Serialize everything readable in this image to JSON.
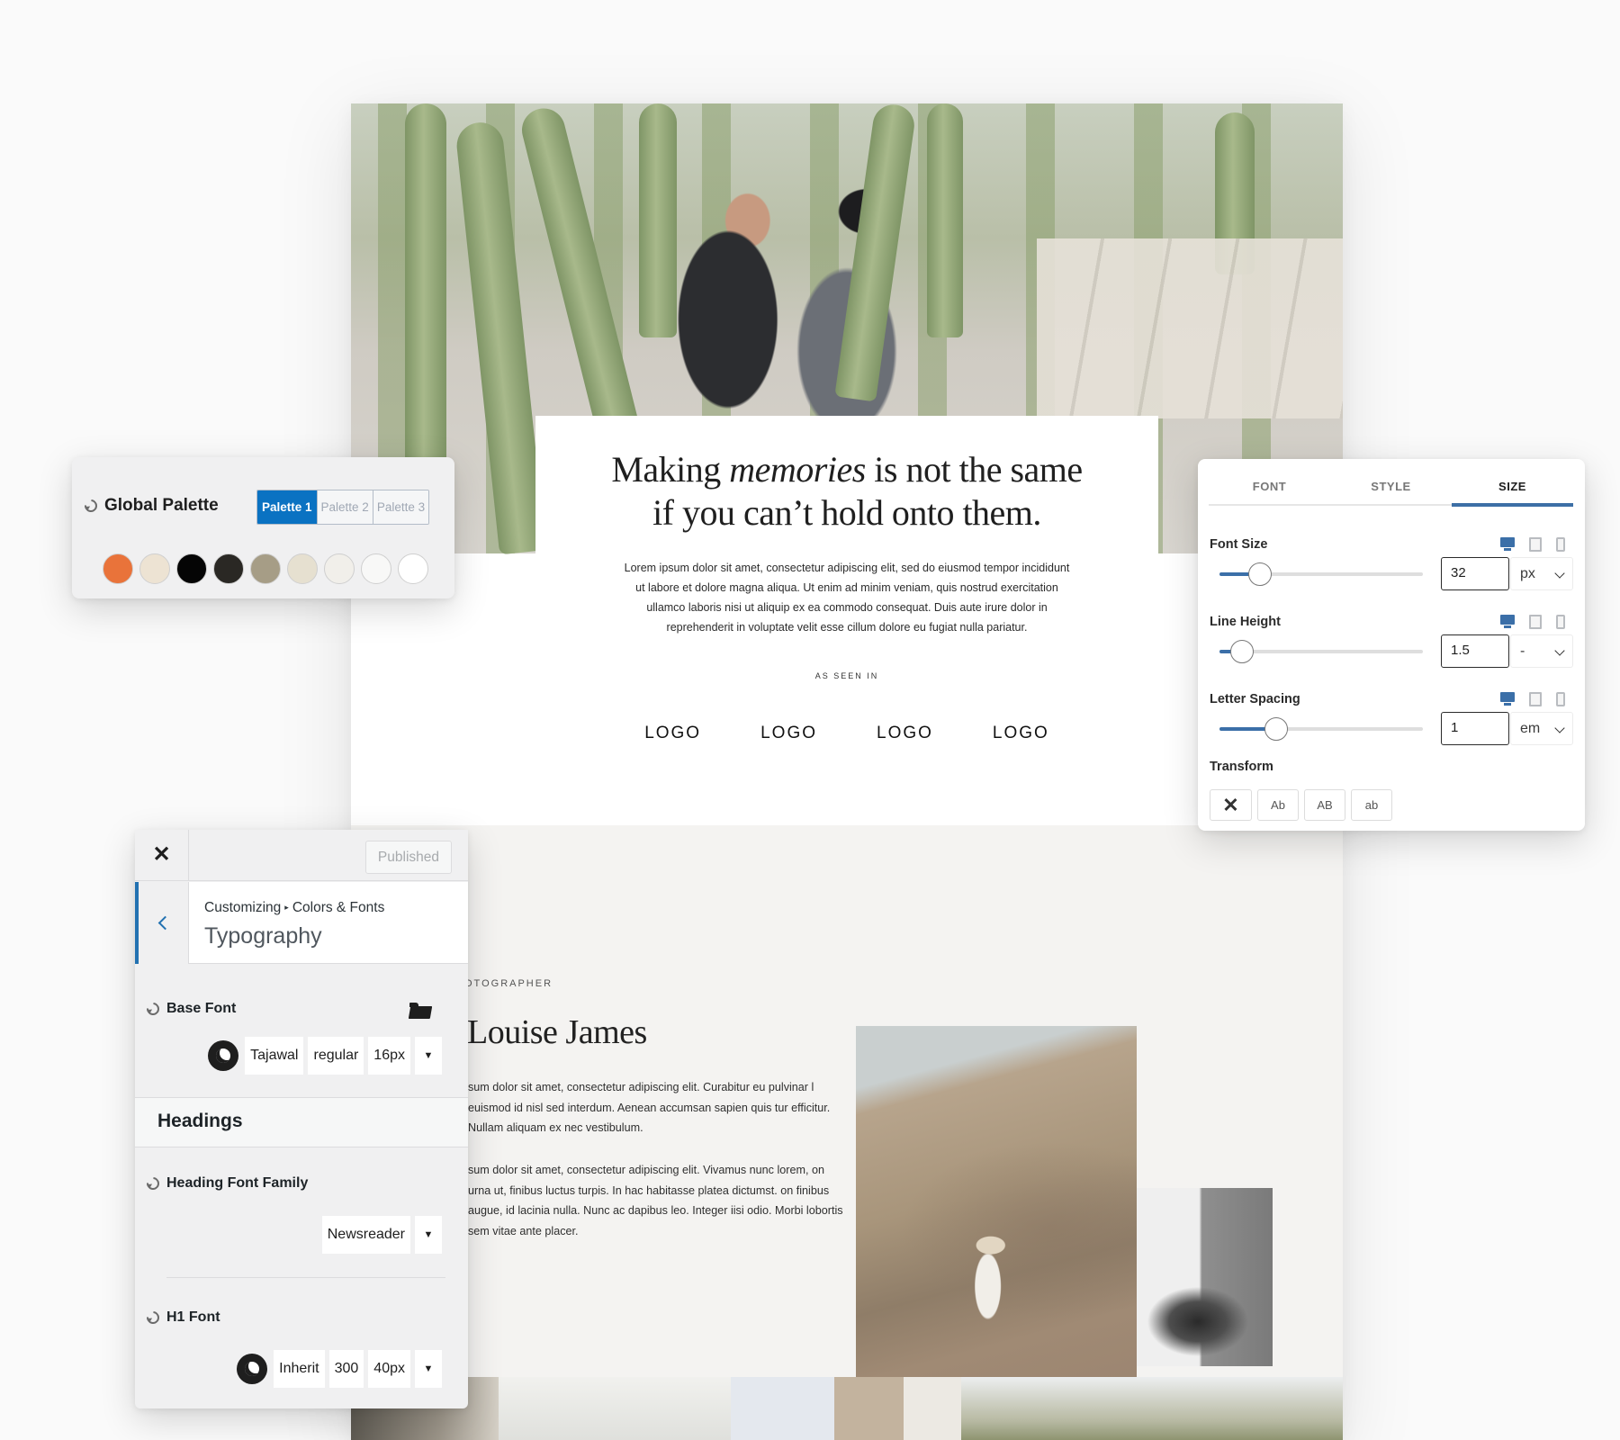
{
  "site": {
    "hero": {
      "title_before": "Making ",
      "title_italic": "memories",
      "title_after": " is not the same",
      "title_line2": "if you can’t hold onto them.",
      "body": "Lorem ipsum dolor sit amet, consectetur adipiscing elit, sed do eiusmod tempor incididunt ut labore et dolore magna aliqua. Ut enim ad minim veniam, quis nostrud exercitation ullamco laboris nisi ut aliquip ex ea commodo consequat. Duis aute irure dolor in reprehenderit in voluptate velit esse cillum dolore eu fugiat nulla pariatur.",
      "as_seen_in": "AS SEEN IN",
      "logos": [
        "LOGO",
        "LOGO",
        "LOGO",
        "LOGO"
      ]
    },
    "about": {
      "eyebrow": "OTOGRAPHER",
      "name": "Louise James",
      "paragraph1": "sum dolor sit amet, consectetur adipiscing elit. Curabitur eu pulvinar l euismod id nisl sed interdum. Aenean accumsan sapien quis tur efficitur. Nullam aliquam ex nec vestibulum.",
      "paragraph2": "sum dolor sit amet, consectetur adipiscing elit. Vivamus nunc lorem, on urna ut, finibus luctus turpis. In hac habitasse platea dictumst. on finibus augue, id lacinia nulla. Nunc ac dapibus leo. Integer iisi odio. Morbi lobortis sem vitae ante placer."
    }
  },
  "global_palette": {
    "title": "Global Palette",
    "tabs": [
      {
        "label": "Palette 1",
        "active": true
      },
      {
        "label": "Palette 2",
        "active": false
      },
      {
        "label": "Palette 3",
        "active": false
      }
    ],
    "swatches": [
      "#e9733a",
      "#ede3d3",
      "#050505",
      "#2a2824",
      "#a69d86",
      "#e6e0d0",
      "#f1efea",
      "#f8f8f7",
      "#ffffff"
    ]
  },
  "typography_panel": {
    "tabs": [
      {
        "label": "FONT",
        "active": false
      },
      {
        "label": "STYLE",
        "active": false
      },
      {
        "label": "SIZE",
        "active": true
      }
    ],
    "controls": [
      {
        "label": "Font Size",
        "value": "32",
        "unit": "px",
        "slider_fraction": 0.2
      },
      {
        "label": "Line Height",
        "value": "1.5",
        "unit": "-",
        "slider_fraction": 0.11
      },
      {
        "label": "Letter Spacing",
        "value": "1",
        "unit": "em",
        "slider_fraction": 0.28
      }
    ],
    "devices": [
      "desktop",
      "tablet",
      "mobile"
    ],
    "active_device": "desktop",
    "transform_label": "Transform",
    "transform_options": [
      "Ab",
      "AB",
      "ab"
    ],
    "accent": "#3b6fa8"
  },
  "customizer": {
    "published_label": "Published",
    "breadcrumb_root": "Customizing",
    "breadcrumb_sep": "▸",
    "breadcrumb_section": "Colors & Fonts",
    "title": "Typography",
    "base_font": {
      "label": "Base Font",
      "family": "Tajawal",
      "weight": "regular",
      "size": "16px"
    },
    "headings_label": "Headings",
    "heading_font_family": {
      "label": "Heading Font Family",
      "family": "Newsreader"
    },
    "h1_font": {
      "label": "H1 Font",
      "family": "Inherit",
      "weight": "300",
      "size": "40px"
    },
    "accent": "#2271b1"
  }
}
